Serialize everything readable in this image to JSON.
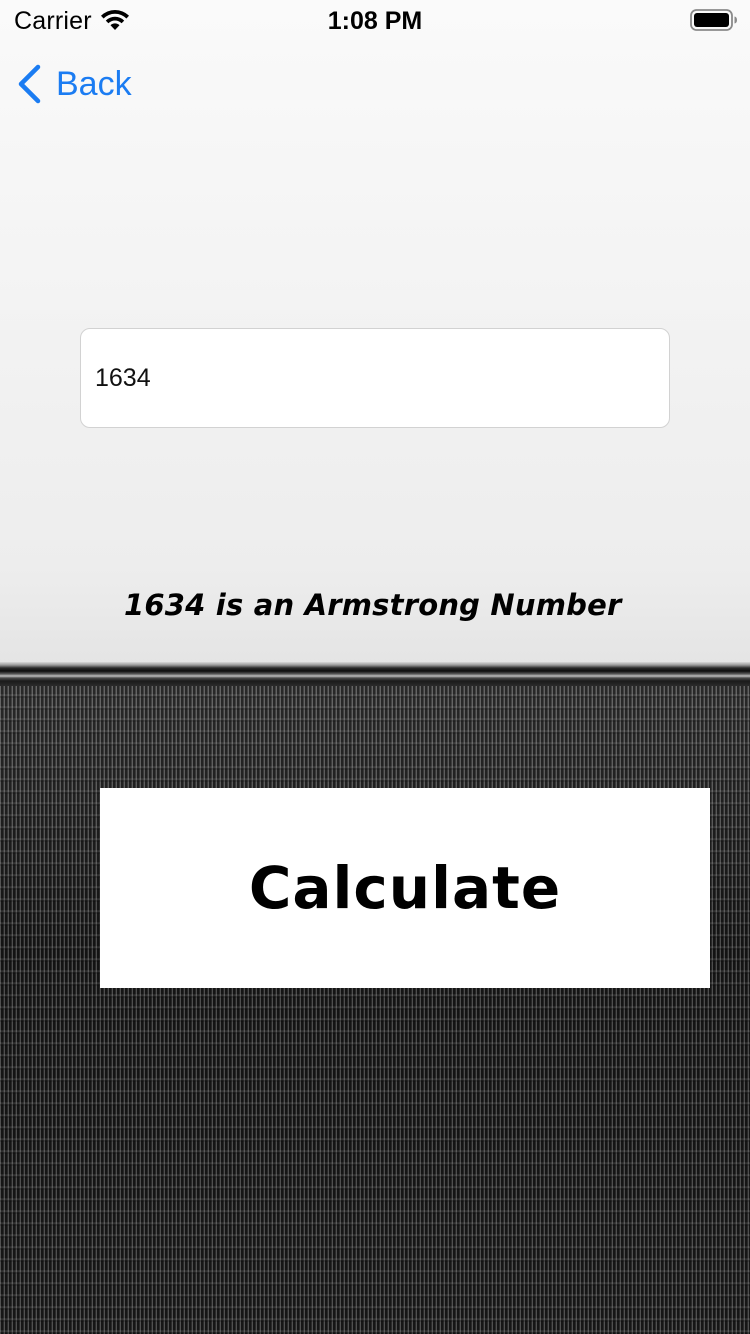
{
  "status_bar": {
    "carrier": "Carrier",
    "time": "1:08 PM",
    "wifi_icon": "wifi-icon",
    "battery_icon": "battery-icon"
  },
  "nav": {
    "back_label": "Back",
    "back_icon": "chevron-left-icon",
    "accent_color": "#1b7cf2"
  },
  "form": {
    "number_value": "1634"
  },
  "result": {
    "text": "1634 is an Armstrong Number"
  },
  "actions": {
    "calculate_label": "Calculate"
  }
}
